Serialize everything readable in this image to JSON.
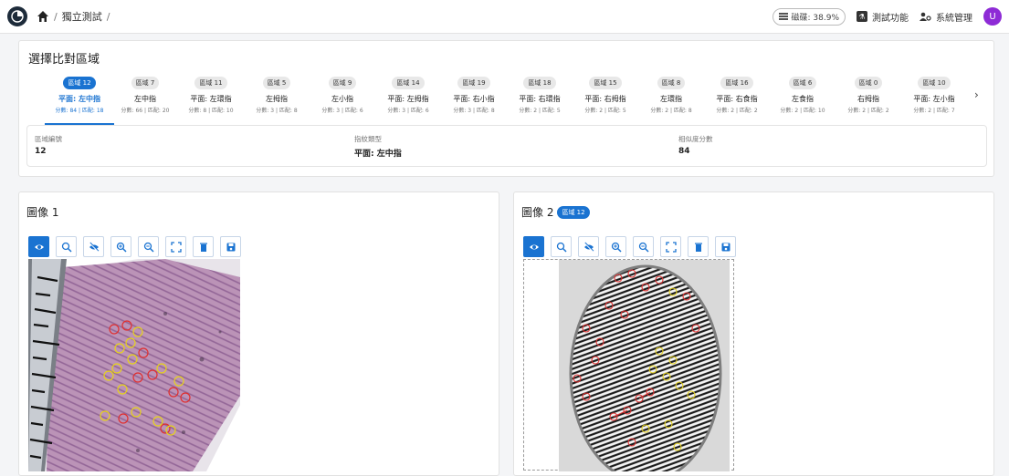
{
  "header": {
    "breadcrumb": [
      "獨立測試"
    ],
    "breadcrumb_sep": "/",
    "disk_label": "磁碟: 38.9%",
    "test_label": "測試功能",
    "admin_label": "系統管理",
    "avatar_initial": "U"
  },
  "region_panel": {
    "title": "選擇比對區域",
    "regions": [
      {
        "chip": "區域 12",
        "name": "平面: 左中指",
        "score": "分數: 84 | 匹配: 18"
      },
      {
        "chip": "區域 7",
        "name": "左中指",
        "score": "分數: 66 | 匹配: 20"
      },
      {
        "chip": "區域 11",
        "name": "平面: 左環指",
        "score": "分數: 8 | 匹配: 10"
      },
      {
        "chip": "區域 5",
        "name": "左拇指",
        "score": "分數: 3 | 匹配: 8"
      },
      {
        "chip": "區域 9",
        "name": "左小指",
        "score": "分數: 3 | 匹配: 6"
      },
      {
        "chip": "區域 14",
        "name": "平面: 左拇指",
        "score": "分數: 3 | 匹配: 6"
      },
      {
        "chip": "區域 19",
        "name": "平面: 右小指",
        "score": "分數: 3 | 匹配: 8"
      },
      {
        "chip": "區域 18",
        "name": "平面: 右環指",
        "score": "分數: 2 | 匹配: 5"
      },
      {
        "chip": "區域 15",
        "name": "平面: 右拇指",
        "score": "分數: 2 | 匹配: 5"
      },
      {
        "chip": "區域 8",
        "name": "左環指",
        "score": "分數: 2 | 匹配: 8"
      },
      {
        "chip": "區域 16",
        "name": "平面: 右食指",
        "score": "分數: 2 | 匹配: 2"
      },
      {
        "chip": "區域 6",
        "name": "左食指",
        "score": "分數: 2 | 匹配: 10"
      },
      {
        "chip": "區域 0",
        "name": "右拇指",
        "score": "分數: 2 | 匹配: 2"
      },
      {
        "chip": "區域 10",
        "name": "平面: 左小指",
        "score": "分數: 2 | 匹配: 7"
      }
    ],
    "info": {
      "region_label": "區域編號",
      "region_value": "12",
      "type_label": "指紋類型",
      "type_value": "平面: 左中指",
      "score_label": "相似度分數",
      "score_value": "84"
    }
  },
  "image1": {
    "title": "圖像 1"
  },
  "image2": {
    "title": "圖像 2",
    "badge": "區域 12"
  },
  "toolbar_icons": [
    "eye-icon",
    "zoom-region-icon",
    "eye-off-icon",
    "zoom-in-icon",
    "zoom-out-icon",
    "fit-screen-icon",
    "trash-icon",
    "save-icon"
  ],
  "colors": {
    "accent": "#1a73d1",
    "avatar": "#8e2bd6",
    "minutia_red": "#e03030",
    "minutia_yellow": "#e6d21c"
  }
}
